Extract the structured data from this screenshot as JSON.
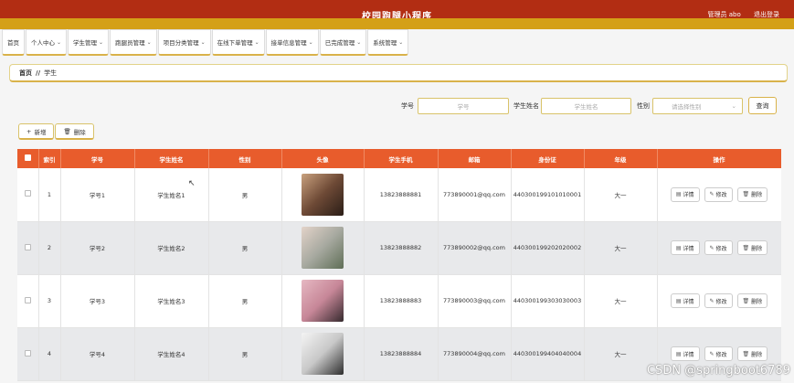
{
  "header": {
    "title": "校园跑腿小程序",
    "user_label": "管理员 abo",
    "logout": "退出登录"
  },
  "nav": [
    {
      "label": "首页",
      "dropdown": false
    },
    {
      "label": "个人中心",
      "dropdown": true
    },
    {
      "label": "学生管理",
      "dropdown": true
    },
    {
      "label": "跑腿员管理",
      "dropdown": true
    },
    {
      "label": "项目分类管理",
      "dropdown": true
    },
    {
      "label": "在线下单管理",
      "dropdown": true
    },
    {
      "label": "接单信息管理",
      "dropdown": true
    },
    {
      "label": "已完成管理",
      "dropdown": true
    },
    {
      "label": "系统管理",
      "dropdown": true
    }
  ],
  "breadcrumb": {
    "home": "首页",
    "sep": "//",
    "current": "学生"
  },
  "search": {
    "id_label": "学号",
    "id_placeholder": "学号",
    "name_label": "学生姓名",
    "name_placeholder": "学生姓名",
    "gender_label": "性别",
    "gender_placeholder": "请选择性别",
    "query_button": "查询"
  },
  "actions": {
    "add": "新增",
    "delete": "删除"
  },
  "table": {
    "columns": [
      "索引",
      "学号",
      "学生姓名",
      "性别",
      "头像",
      "学生手机",
      "邮箱",
      "身份证",
      "年级",
      "操作"
    ],
    "ops": {
      "detail": "详情",
      "edit": "修改",
      "delete": "删除"
    },
    "rows": [
      {
        "index": "1",
        "id": "学号1",
        "name": "学生姓名1",
        "gender": "男",
        "phone": "13823888881",
        "email": "773890001@qq.com",
        "idcard": "440300199101010001",
        "grade": "大一"
      },
      {
        "index": "2",
        "id": "学号2",
        "name": "学生姓名2",
        "gender": "男",
        "phone": "13823888882",
        "email": "773890002@qq.com",
        "idcard": "440300199202020002",
        "grade": "大一"
      },
      {
        "index": "3",
        "id": "学号3",
        "name": "学生姓名3",
        "gender": "男",
        "phone": "13823888883",
        "email": "773890003@qq.com",
        "idcard": "440300199303030003",
        "grade": "大一"
      },
      {
        "index": "4",
        "id": "学号4",
        "name": "学生姓名4",
        "gender": "男",
        "phone": "13823888884",
        "email": "773890004@qq.com",
        "idcard": "440300199404040004",
        "grade": "大一"
      }
    ]
  },
  "watermark": "CSDN @springboot6789"
}
